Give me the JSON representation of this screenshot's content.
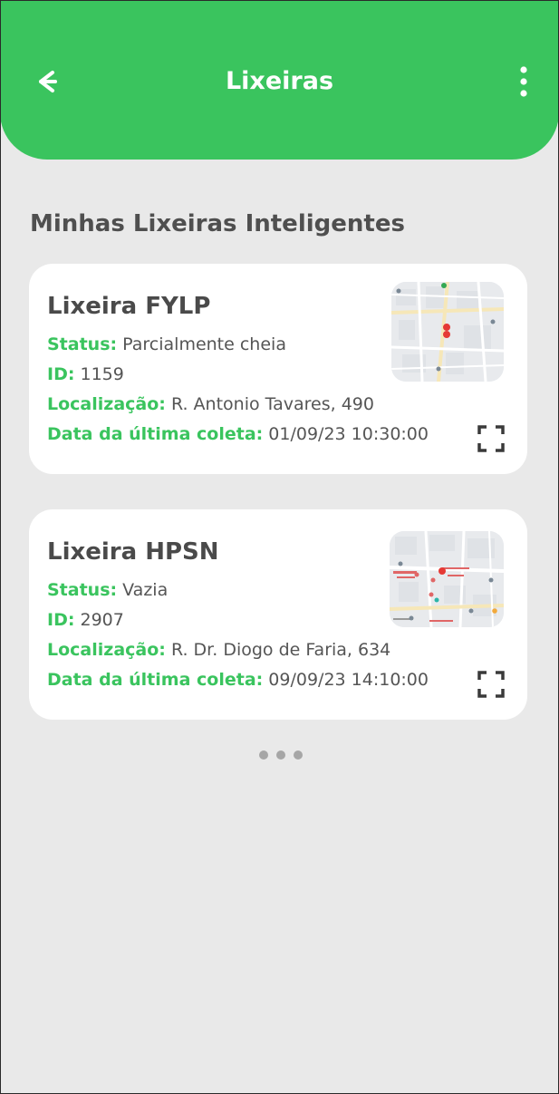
{
  "header": {
    "title": "Lixeiras",
    "back_icon": "chevron-left-icon",
    "menu_icon": "more-vertical-icon",
    "color": "#3ac45e"
  },
  "section": {
    "title": "Minhas Lixeiras Inteligentes"
  },
  "labels": {
    "status": "Status:",
    "id": "ID:",
    "location": "Localização:",
    "last_collection": "Data da última coleta:"
  },
  "bins": [
    {
      "name": "Lixeira FYLP",
      "status": "Parcialmente cheia",
      "id": "1159",
      "location": "R. Antonio Tavares, 490",
      "last_collection": "01/09/23 10:30:00"
    },
    {
      "name": "Lixeira HPSN",
      "status": "Vazia",
      "id": "2907",
      "location": "R. Dr. Diogo de Faria, 634",
      "last_collection": "09/09/23 14:10:00"
    }
  ],
  "icons": {
    "map_thumbnail": "map-thumbnail",
    "expand": "expand-icon",
    "more": "more-dots-icon"
  }
}
